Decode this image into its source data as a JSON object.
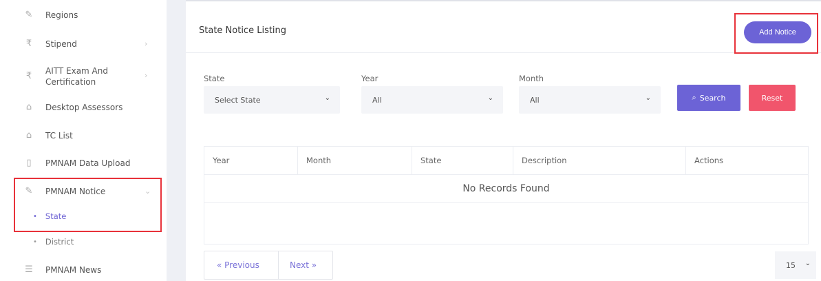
{
  "sidebar": {
    "items": [
      {
        "label": "Regions",
        "icon": "pencil-icon",
        "glyph": "✎"
      },
      {
        "label": "Stipend",
        "icon": "rupee-icon",
        "glyph": "₹",
        "has_children": true
      },
      {
        "label": "AITT Exam And",
        "label2": "Certification",
        "icon": "rupee-icon",
        "glyph": "₹",
        "has_children": true
      },
      {
        "label": "Desktop Assessors",
        "icon": "home-icon",
        "glyph": "⌂"
      },
      {
        "label": "TC List",
        "icon": "home-icon",
        "glyph": "⌂"
      },
      {
        "label": "PMNAM Data Upload",
        "icon": "document-icon",
        "glyph": "▯"
      },
      {
        "label": "PMNAM Notice",
        "icon": "pencil-icon",
        "glyph": "✎",
        "expanded": true,
        "children": [
          {
            "label": "State",
            "active": true
          },
          {
            "label": "District"
          }
        ]
      },
      {
        "label": "PMNAM News",
        "icon": "list-icon",
        "glyph": "☰"
      }
    ],
    "chevron": "›",
    "chevron_open": "⌄",
    "bullet": "•"
  },
  "main": {
    "title": "State Notice Listing",
    "add_button": "Add Notice",
    "filters": {
      "state": {
        "label": "State",
        "value": "Select State"
      },
      "year": {
        "label": "Year",
        "value": "All"
      },
      "month": {
        "label": "Month",
        "value": "All"
      }
    },
    "caret": "⌄",
    "search_button": "Search",
    "search_glyph": "⌕",
    "reset_button": "Reset",
    "table": {
      "columns": [
        "Year",
        "Month",
        "State",
        "Description",
        "Actions"
      ],
      "empty_text": "No Records Found"
    },
    "pagination": {
      "previous": "« Previous",
      "next": "Next »"
    },
    "per_page": "15"
  },
  "colors": {
    "accent": "#6c63d6",
    "reset": "#f1556c",
    "highlight": "#e8323a"
  }
}
